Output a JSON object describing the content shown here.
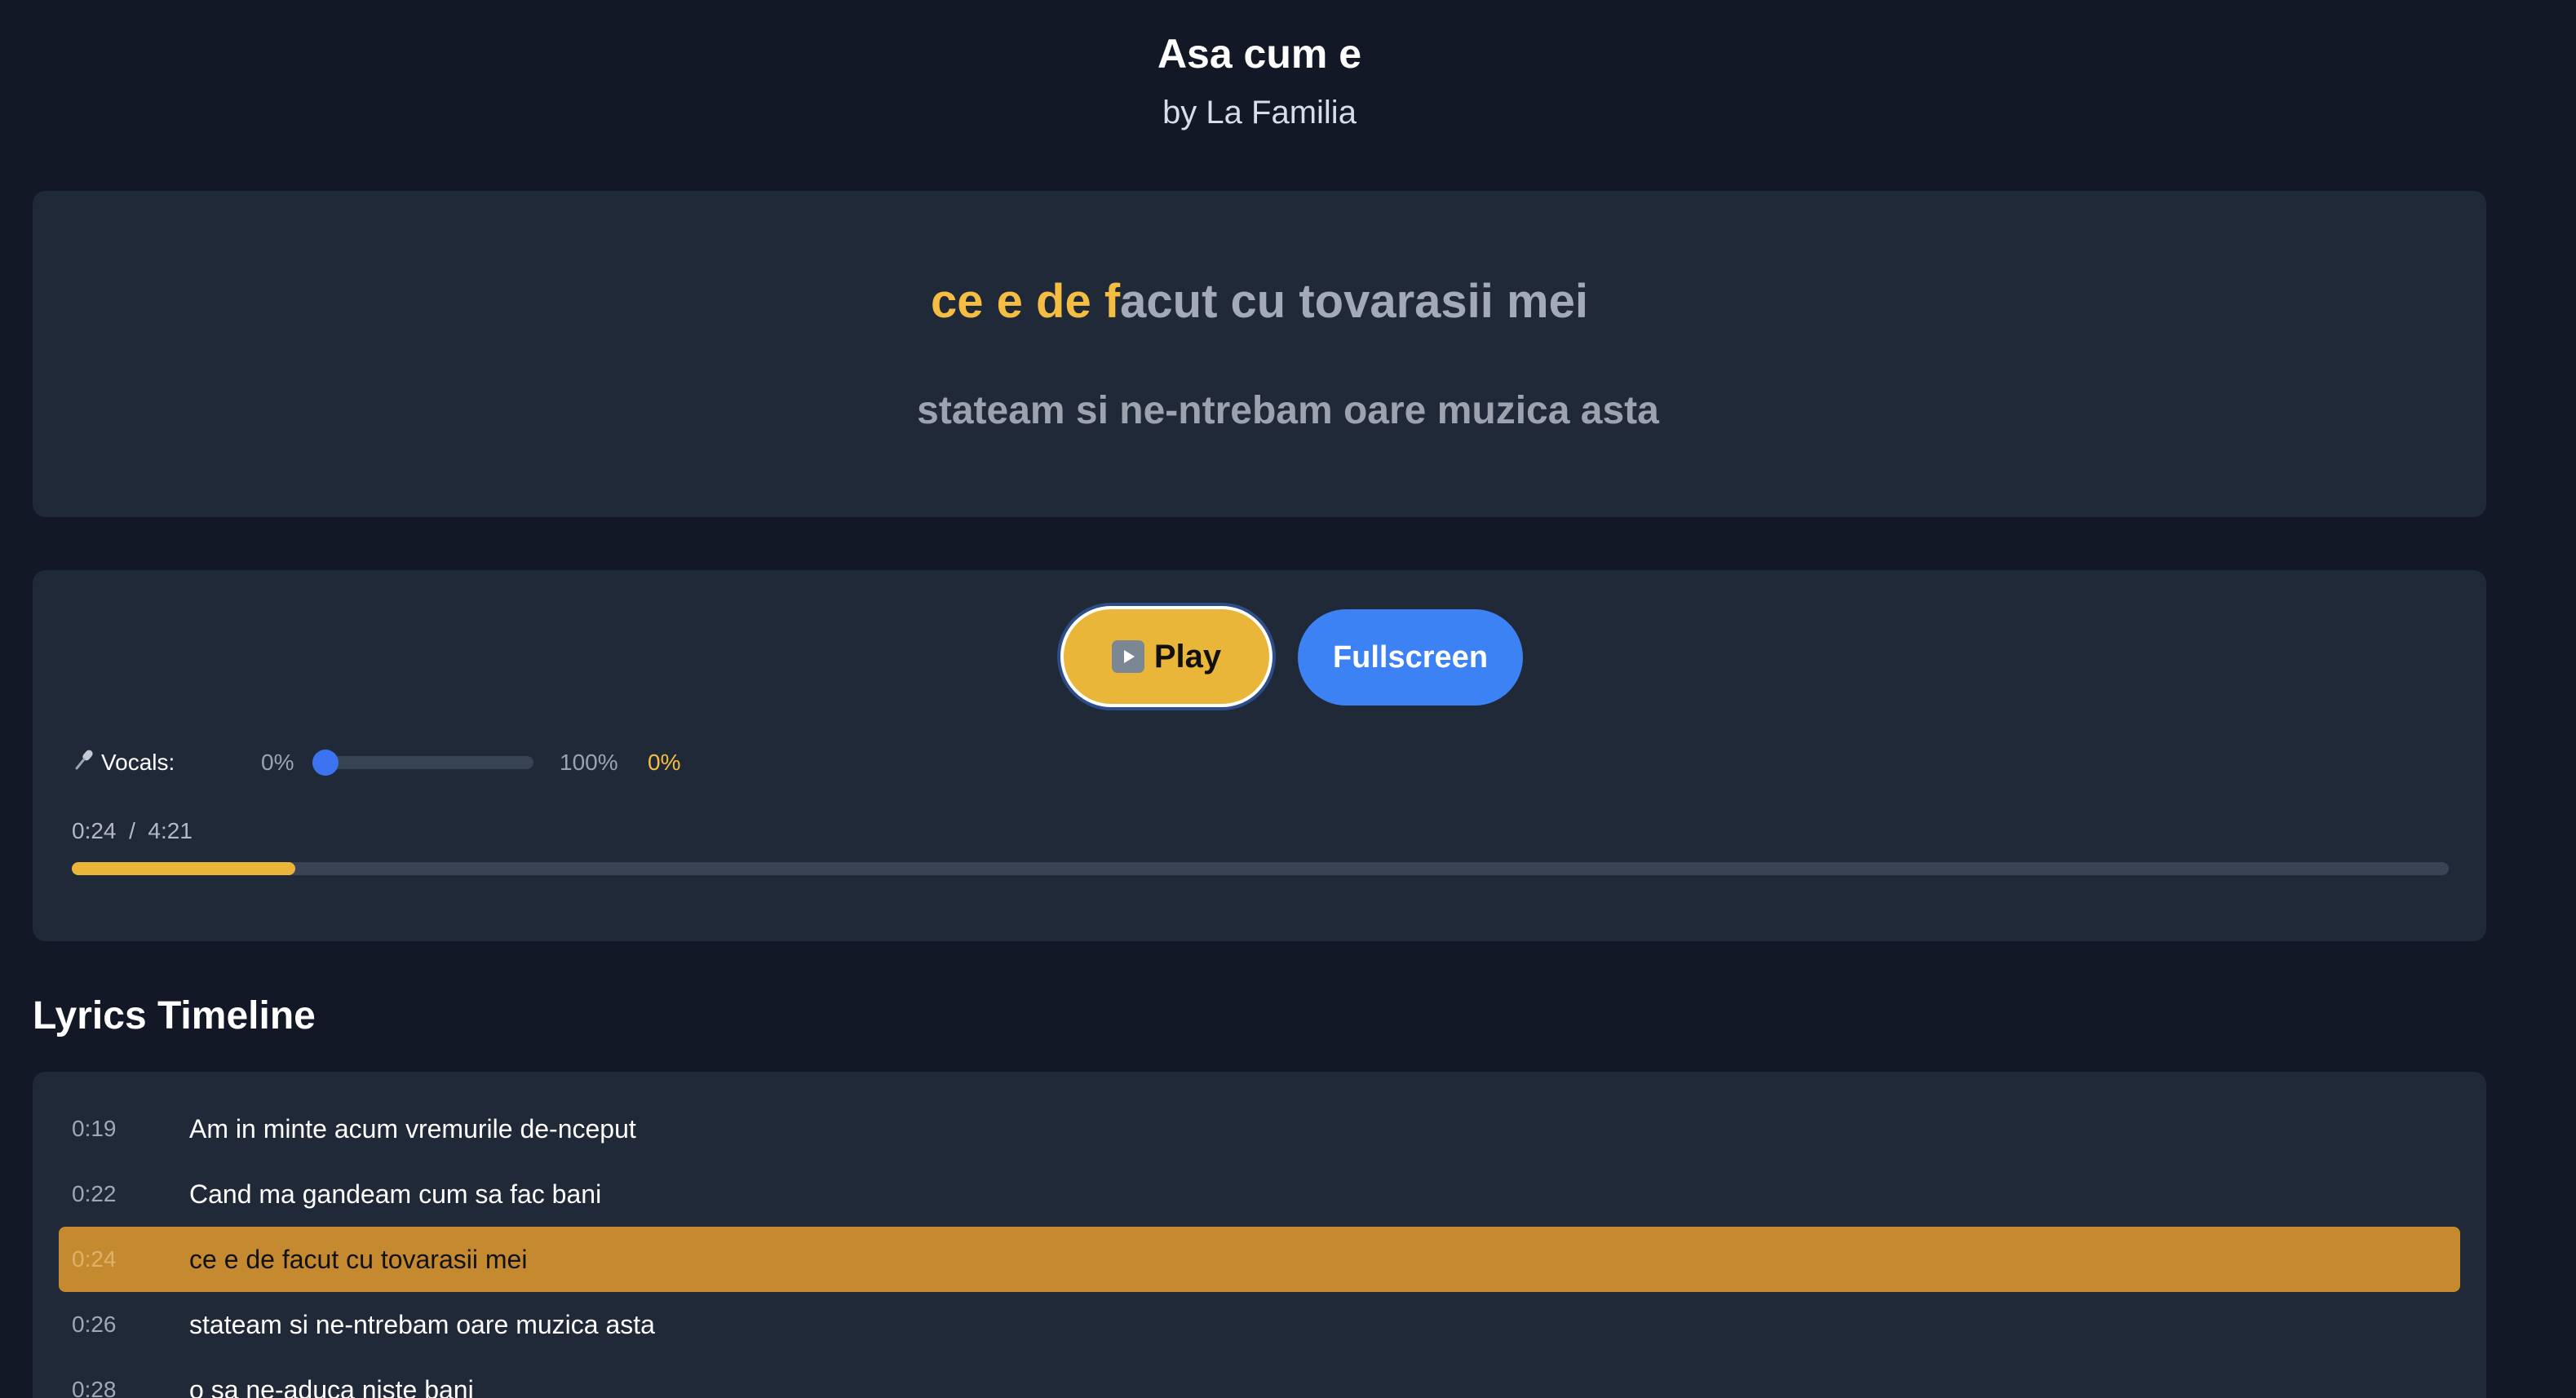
{
  "song": {
    "title": "Asa cum e",
    "artist_line": "by La Familia"
  },
  "lyrics_display": {
    "current_sung": "ce e de f",
    "current_unsung": "acut cu tovarasii mei",
    "next_line": "stateam si ne-ntrebam oare muzica asta"
  },
  "controls": {
    "play_label": "Play",
    "fullscreen_label": "Fullscreen",
    "vocals": {
      "label": "Vocals:",
      "min_label": "0%",
      "max_label": "100%",
      "value_label": "0%",
      "level": 0
    },
    "time": {
      "current": "0:24",
      "separator": "/",
      "total": "4:21"
    },
    "progress_fraction": 0.094
  },
  "timeline": {
    "heading": "Lyrics Timeline",
    "active_index": 2,
    "rows": [
      {
        "time": "0:19",
        "text": "Am in minte acum vremurile de-nceput"
      },
      {
        "time": "0:22",
        "text": "Cand ma gandeam cum sa fac bani"
      },
      {
        "time": "0:24",
        "text": "ce e de facut cu tovarasii mei"
      },
      {
        "time": "0:26",
        "text": "stateam si ne-ntrebam oare muzica asta"
      },
      {
        "time": "0:28",
        "text": "o sa ne-aduca niste bani"
      }
    ]
  },
  "colors": {
    "background": "#121826",
    "card": "#1f2938",
    "accent_gold": "#f5bd42",
    "play_button": "#e9b63a",
    "fullscreen_button": "#3d82f5",
    "active_row": "#c58a30"
  },
  "icons": {
    "play": "play-icon",
    "vocals": "microphone-icon"
  }
}
